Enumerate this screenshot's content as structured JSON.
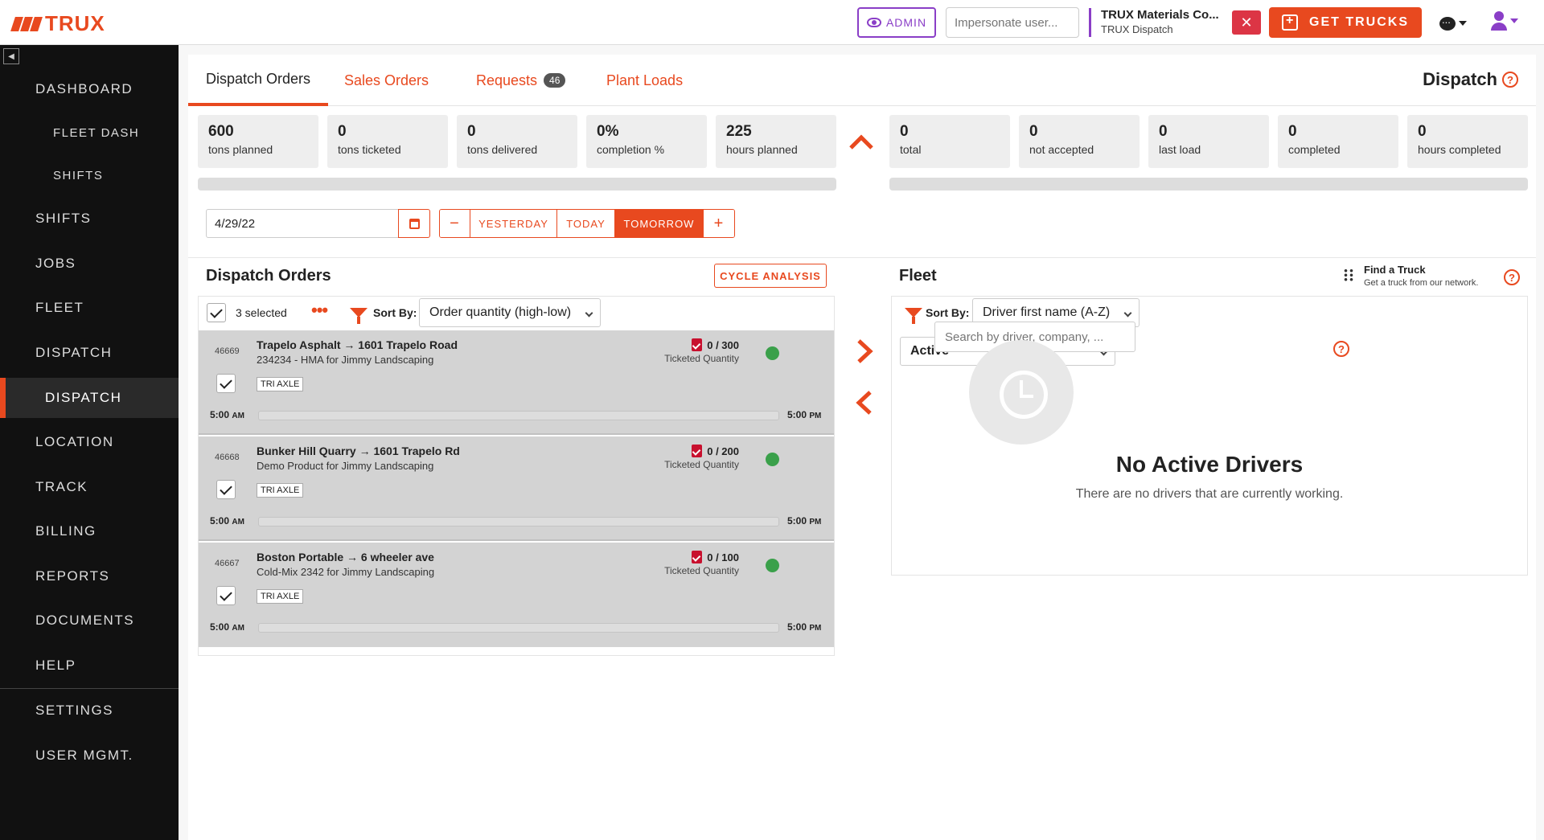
{
  "header": {
    "logo_text": "TRUX",
    "admin_label": "ADMIN",
    "impersonate_placeholder": "Impersonate user...",
    "company_name": "TRUX Materials Co...",
    "company_sub": "TRUX Dispatch",
    "close_label": "✕",
    "get_trucks_label": "GET TRUCKS"
  },
  "sidebar": {
    "items": [
      {
        "label": "DASHBOARD"
      },
      {
        "label": "FLEET DASH"
      },
      {
        "label": "SHIFTS"
      },
      {
        "label": "SHIFTS"
      },
      {
        "label": "JOBS"
      },
      {
        "label": "FLEET"
      },
      {
        "label": "DISPATCH"
      },
      {
        "label": "DISPATCH"
      },
      {
        "label": "LOCATION"
      },
      {
        "label": "TRACK"
      },
      {
        "label": "BILLING"
      },
      {
        "label": "REPORTS"
      },
      {
        "label": "DOCUMENTS"
      },
      {
        "label": "HELP"
      },
      {
        "label": "SETTINGS"
      },
      {
        "label": "USER MGMT."
      }
    ]
  },
  "tabs": [
    {
      "label": "Dispatch Orders"
    },
    {
      "label": "Sales Orders"
    },
    {
      "label": "Requests",
      "badge": "46"
    },
    {
      "label": "Plant Loads"
    }
  ],
  "page_title": "Dispatch",
  "stats_left": [
    {
      "value": "600",
      "label": "tons planned"
    },
    {
      "value": "0",
      "label": "tons ticketed"
    },
    {
      "value": "0",
      "label": "tons delivered"
    },
    {
      "value": "0%",
      "label": "completion %"
    },
    {
      "value": "225",
      "label": "hours planned"
    }
  ],
  "stats_right": [
    {
      "value": "0",
      "label": "total"
    },
    {
      "value": "0",
      "label": "not accepted"
    },
    {
      "value": "0",
      "label": "last load"
    },
    {
      "value": "0",
      "label": "completed"
    },
    {
      "value": "0",
      "label": "hours completed"
    }
  ],
  "date": {
    "value": "4/29/22",
    "minus": "−",
    "yesterday": "YESTERDAY",
    "today": "TODAY",
    "tomorrow": "TOMORROW",
    "plus": "+"
  },
  "orders": {
    "title": "Dispatch Orders",
    "cycle_label": "CYCLE ANALYSIS",
    "selected_text": "3 selected",
    "sort_label": "Sort By:",
    "sort_value": "Order quantity (high-low)",
    "items": [
      {
        "id": "46669",
        "route": "Trapelo Asphalt → 1601 Trapelo Road",
        "desc": "234234 - HMA for Jimmy Landscaping",
        "tag": "TRI AXLE",
        "qty": "0 / 300",
        "qty_label": "Ticketed Quantity",
        "start": "5:00",
        "start_ampm": "AM",
        "end": "5:00",
        "end_ampm": "PM"
      },
      {
        "id": "46668",
        "route": "Bunker Hill Quarry → 1601 Trapelo Rd",
        "desc": "Demo Product for Jimmy Landscaping",
        "tag": "TRI AXLE",
        "qty": "0 / 200",
        "qty_label": "Ticketed Quantity",
        "start": "5:00",
        "start_ampm": "AM",
        "end": "5:00",
        "end_ampm": "PM"
      },
      {
        "id": "46667",
        "route": "Boston Portable → 6 wheeler ave",
        "desc": "Cold-Mix 2342 for Jimmy Landscaping",
        "tag": "TRI AXLE",
        "qty": "0 / 100",
        "qty_label": "Ticketed Quantity",
        "start": "5:00",
        "start_ampm": "AM",
        "end": "5:00",
        "end_ampm": "PM"
      }
    ]
  },
  "fleet": {
    "title": "Fleet",
    "find_title": "Find a Truck",
    "find_sub": "Get a truck from our network.",
    "sort_label": "Sort By:",
    "sort_value": "Driver first name (A-Z)",
    "status_value": "Active",
    "search_placeholder": "Search by driver, company, ...",
    "empty_title": "No Active Drivers",
    "empty_sub": "There are no drivers that are currently working."
  },
  "colors": {
    "accent": "#e8491f",
    "admin": "#8a3ec7",
    "status_ok": "#3aa04a"
  }
}
